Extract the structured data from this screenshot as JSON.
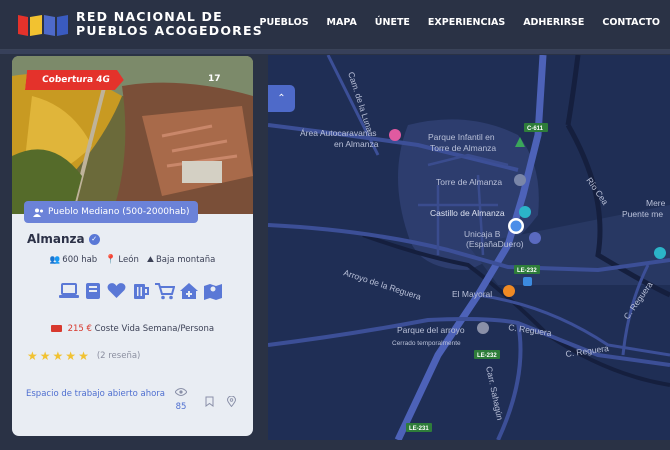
{
  "brand": {
    "line1": "RED NACIONAL DE",
    "line2": "PUEBLOS ACOGEDORES",
    "logo_colors": [
      "#e4322b",
      "#f2c230",
      "#4e6ac9",
      "#3a5bc0"
    ]
  },
  "nav": [
    "PUEBLOS",
    "MAPA",
    "ÚNETE",
    "EXPERIENCIAS",
    "ADHERIRSE",
    "CONTACTO"
  ],
  "card": {
    "badge": "Cobertura 4G",
    "photo_count": "17",
    "size": "Pueblo Mediano (500-2000hab)",
    "name": "Almanza",
    "population": "600 hab",
    "province": "León",
    "terrain": "Baja montaña",
    "services_icons": [
      "laptop-icon",
      "book-icon",
      "heart-icon",
      "beer-icon",
      "cart-icon",
      "medical-house-icon",
      "map-icon"
    ],
    "cost_price": "215 €",
    "cost_label": "Coste Vida Semana/Persona",
    "stars": 5,
    "reviews": "(2 reseña)",
    "workspace": "Espacio de trabajo abierto ahora",
    "views": "85"
  },
  "map": {
    "labels": {
      "road_luna": "Cam. de la Luna",
      "autocaravanas": "Área Autocaravanas en Almanza",
      "parque_infantil": "Parque Infantil en Torre de Almanza",
      "c611": "C-611",
      "torre": "Torre de Almanza",
      "castillo": "Castillo de Almanza",
      "unicaja": "Unicaja B... (EspañaDuero)",
      "le232": "LE-232",
      "mayoral": "El Mayoral",
      "arroyo": "Arroyo de la Reguera",
      "parque_arroyo": "Parque del arroyo",
      "cerrado": "Cerrado temporalmente",
      "c_reguera": "C. Reguera",
      "c_reguera2": "C. Reguera",
      "carr_sahagun": "Carr. Sahagún",
      "le231": "LE-231",
      "rio_cea": "Río Cea",
      "mere": "Mere",
      "puente": "Puente me"
    }
  }
}
